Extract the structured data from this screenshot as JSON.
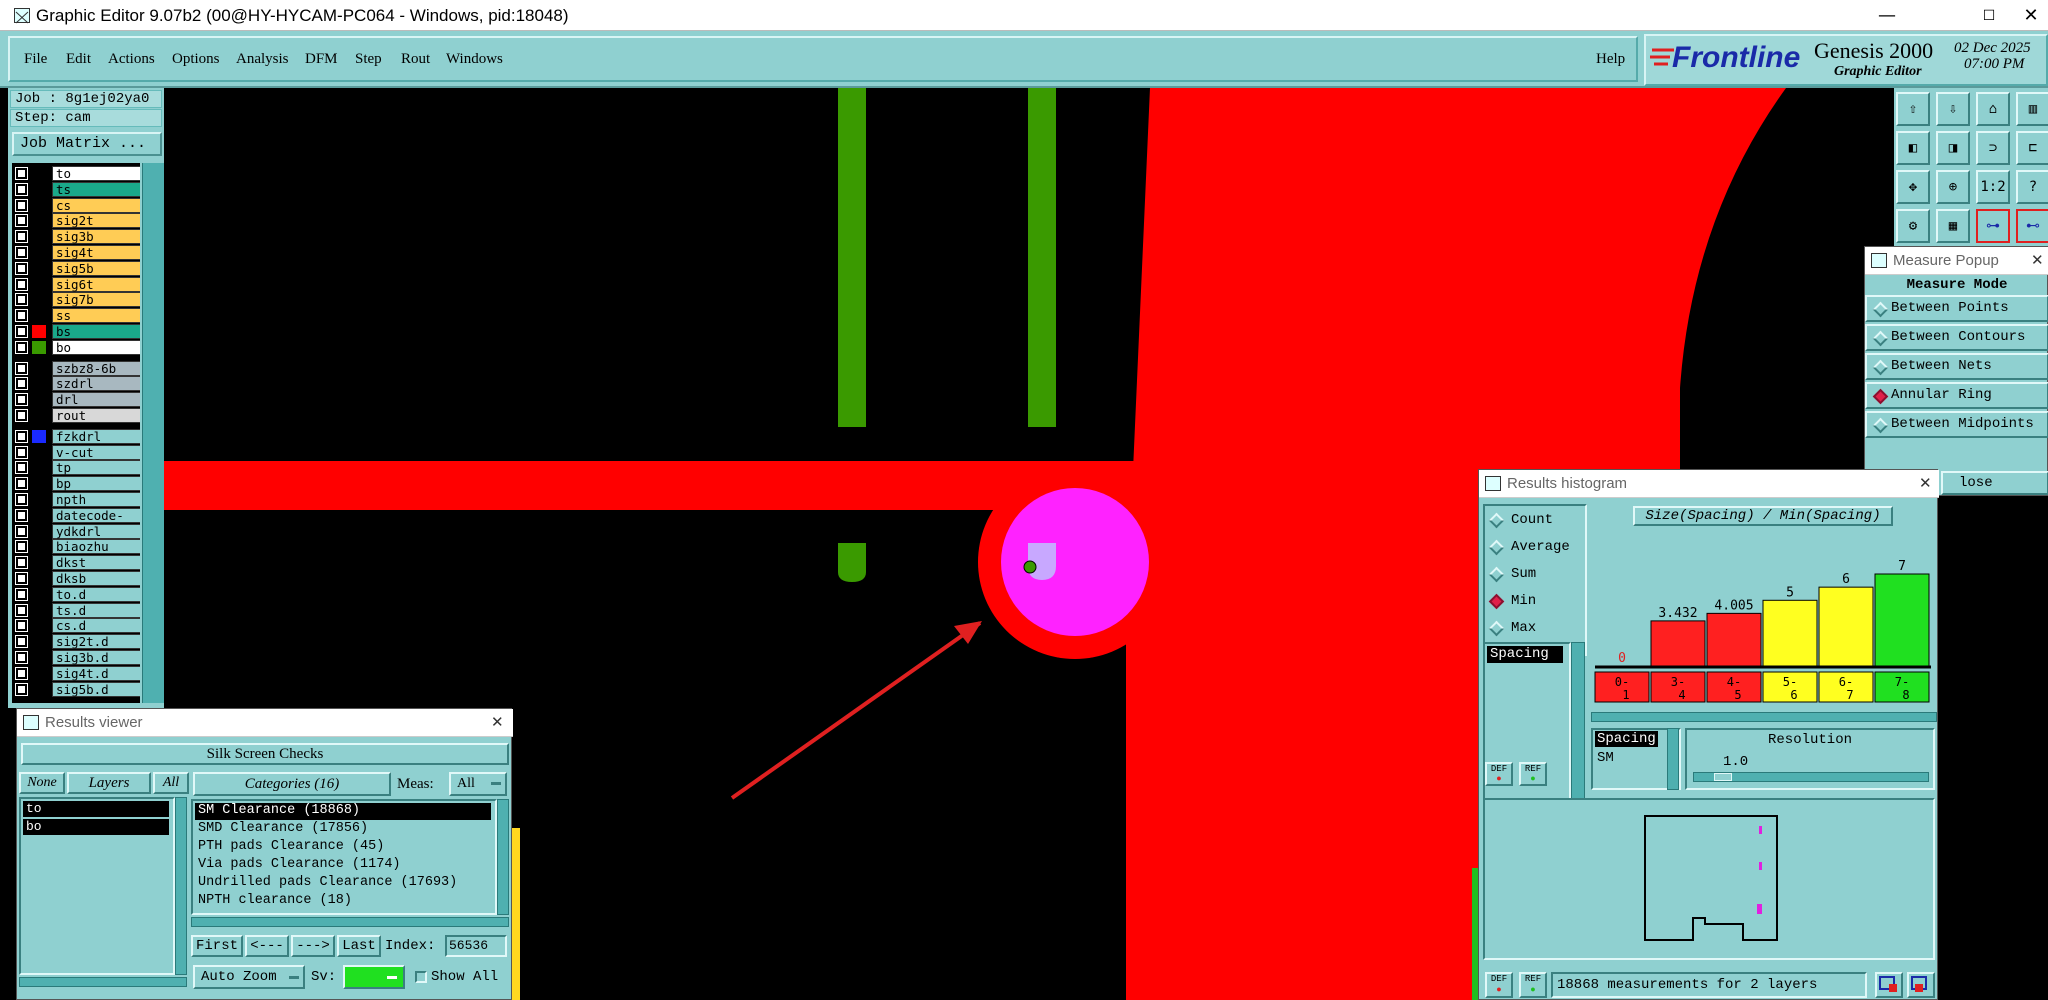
{
  "window": {
    "title": "Graphic Editor 9.07b2 (00@HY-HYCAM-PC064 - Windows, pid:18048)",
    "min_glyph": "—",
    "max_glyph": "☐",
    "close_glyph": "✕"
  },
  "menu": {
    "items": [
      "File",
      "Edit",
      "Actions",
      "Options",
      "Analysis",
      "DFM",
      "Step",
      "Rout",
      "Windows"
    ],
    "help": "Help"
  },
  "brand": {
    "logo": "Frontline",
    "product": "Genesis 2000",
    "subtitle": "Graphic Editor",
    "date": "02 Dec 2025",
    "time": "07:00 PM"
  },
  "job": {
    "job_line": "Job : 8g1ej02ya0",
    "step_line": "Step: cam",
    "matrix_button": "Job Matrix ..."
  },
  "layers": [
    {
      "name": "to",
      "color": "#ffffff",
      "sel": "#000"
    },
    {
      "name": "ts",
      "color": "#1aa88a",
      "sel": "#000"
    },
    {
      "name": "cs",
      "color": "#ffcc55",
      "sel": "#000"
    },
    {
      "name": "sig2t",
      "color": "#ffcc55",
      "sel": "#000"
    },
    {
      "name": "sig3b",
      "color": "#ffcc55",
      "sel": "#000"
    },
    {
      "name": "sig4t",
      "color": "#ffcc55",
      "sel": "#000"
    },
    {
      "name": "sig5b",
      "color": "#ffcc55",
      "sel": "#000"
    },
    {
      "name": "sig6t",
      "color": "#ffcc55",
      "sel": "#000"
    },
    {
      "name": "sig7b",
      "color": "#ffcc55",
      "sel": "#000"
    },
    {
      "name": "ss",
      "color": "#ffcc55",
      "sel": "#000"
    },
    {
      "name": "bs",
      "color": "#1aa88a",
      "sel": "#ff0000"
    },
    {
      "name": "bo",
      "color": "#ffffff",
      "sel": "#3a9a00"
    },
    {
      "name": "szbz8-6b",
      "color": "#a8b8c0",
      "sel": "#000"
    },
    {
      "name": "szdrl",
      "color": "#a8b8c0",
      "sel": "#000"
    },
    {
      "name": "drl",
      "color": "#a8b8c0",
      "sel": "#000"
    },
    {
      "name": "rout",
      "color": "#d8d8d8",
      "sel": "#000"
    },
    {
      "name": "fzkdrl",
      "color": "#8fd0d0",
      "sel": "#1a2aff"
    },
    {
      "name": "v-cut",
      "color": "#8fd0d0",
      "sel": "#000"
    },
    {
      "name": "tp",
      "color": "#8fd0d0",
      "sel": "#000"
    },
    {
      "name": "bp",
      "color": "#8fd0d0",
      "sel": "#000"
    },
    {
      "name": "npth",
      "color": "#8fd0d0",
      "sel": "#000"
    },
    {
      "name": "datecode-pth",
      "color": "#8fd0d0",
      "sel": "#000"
    },
    {
      "name": "ydkdrl",
      "color": "#8fd0d0",
      "sel": "#000"
    },
    {
      "name": "biaozhu",
      "color": "#8fd0d0",
      "sel": "#000"
    },
    {
      "name": "dkst",
      "color": "#8fd0d0",
      "sel": "#000"
    },
    {
      "name": "dksb",
      "color": "#8fd0d0",
      "sel": "#000"
    },
    {
      "name": "to.d",
      "color": "#8fd0d0",
      "sel": "#000"
    },
    {
      "name": "ts.d",
      "color": "#8fd0d0",
      "sel": "#000"
    },
    {
      "name": "cs.d",
      "color": "#8fd0d0",
      "sel": "#000"
    },
    {
      "name": "sig2t.d",
      "color": "#8fd0d0",
      "sel": "#000"
    },
    {
      "name": "sig3b.d",
      "color": "#8fd0d0",
      "sel": "#000"
    },
    {
      "name": "sig4t.d",
      "color": "#8fd0d0",
      "sel": "#000"
    },
    {
      "name": "sig5b.d",
      "color": "#8fd0d0",
      "sel": "#000"
    }
  ],
  "toolbar_icons": [
    "import-icon",
    "export-icon",
    "home-icon",
    "split-view-icon",
    "snap-left-icon",
    "snap-right-icon",
    "link-icon",
    "layout-icon",
    "zoom-fit-icon",
    "zoom-home-icon",
    "scale-1-2-icon",
    "help-icon",
    "measure-tool-icon",
    "grid-icon",
    "net-highlight-icon",
    "net-highlight-2-icon"
  ],
  "toolbar_labels": {
    "scale": "1:2",
    "help": "?"
  },
  "measure_popup": {
    "title": "Measure Popup",
    "mode_label": "Measure Mode",
    "options": [
      "Between Points",
      "Between Contours",
      "Between Nets",
      "Annular Ring",
      "Between Midpoints"
    ],
    "selected": "Annular Ring",
    "close_label": "lose"
  },
  "results_viewer": {
    "title": "Results viewer",
    "header": "Silk Screen Checks",
    "none_btn": "None",
    "layers_btn": "Layers",
    "all_btn": "All",
    "layers": [
      "to",
      "bo"
    ],
    "categories_btn": "Categories (16)",
    "meas_label": "Meas:",
    "meas_value": "All",
    "categories": [
      "SM Clearance (18868)",
      "SMD Clearance (17856)",
      "PTH pads Clearance (45)",
      "Via pads Clearance (1174)",
      "Undrilled pads Clearance (17693)",
      "NPTH clearance (18)"
    ],
    "first": "First",
    "prev": "<---",
    "next": "--->",
    "last": "Last",
    "index_label": "Index:",
    "index_value": "56536",
    "zoom": "Auto Zoom",
    "sv_label": "Sv:",
    "show_all": "Show All"
  },
  "histogram": {
    "title": "Results histogram",
    "modes": [
      "Count",
      "Average",
      "Sum",
      "Min",
      "Max"
    ],
    "selected_mode": "Min",
    "list_item": "Spacing",
    "heading": "Size(Spacing) / Min(Spacing)",
    "spacing_label": "Spacing",
    "sm_label": "SM",
    "resolution_label": "Resolution",
    "resolution_value": "1.0",
    "status": "18868 measurements for 2 layers",
    "def_label": "DEF",
    "ref_label": "REF"
  },
  "chart_data": {
    "type": "bar",
    "title": "Size(Spacing) / Min(Spacing)",
    "categories": [
      "0-1",
      "3-4",
      "4-5",
      "5-6",
      "6-7",
      "7-8"
    ],
    "values": [
      0,
      3.432,
      4.005,
      5,
      6,
      7
    ],
    "value_labels": [
      "0",
      "3.432",
      "4.005",
      "5",
      "6",
      "7"
    ],
    "colors": [
      "#ff2020",
      "#ff2020",
      "#ff2020",
      "#ffff20",
      "#ffff20",
      "#20e020"
    ],
    "ylim": [
      0,
      7
    ]
  }
}
